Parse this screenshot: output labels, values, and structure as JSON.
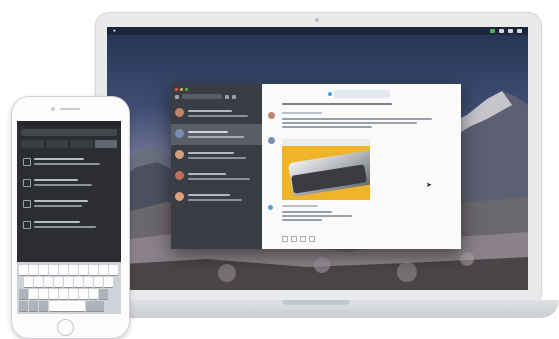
{
  "laptop": {
    "menu_items": [
      "",
      "",
      "",
      "",
      "",
      "",
      "",
      ""
    ]
  },
  "mail_window": {
    "sidebar_rows": 5,
    "selected_row": 1,
    "avatar_colors": [
      "#c0846a",
      "#7a8db3",
      "#d39d7f",
      "#b96f5c",
      "#e1a07c"
    ],
    "conversation_tab": ""
  },
  "phone": {
    "list_items": 4,
    "tabs": 4,
    "keyboard_rows": 4
  },
  "colors": {
    "accent_blue": "#4aa3df",
    "attachment_yellow": "#f0b42b",
    "dark_ui": "#3a3d43",
    "menubar_green": "#4fb450"
  }
}
